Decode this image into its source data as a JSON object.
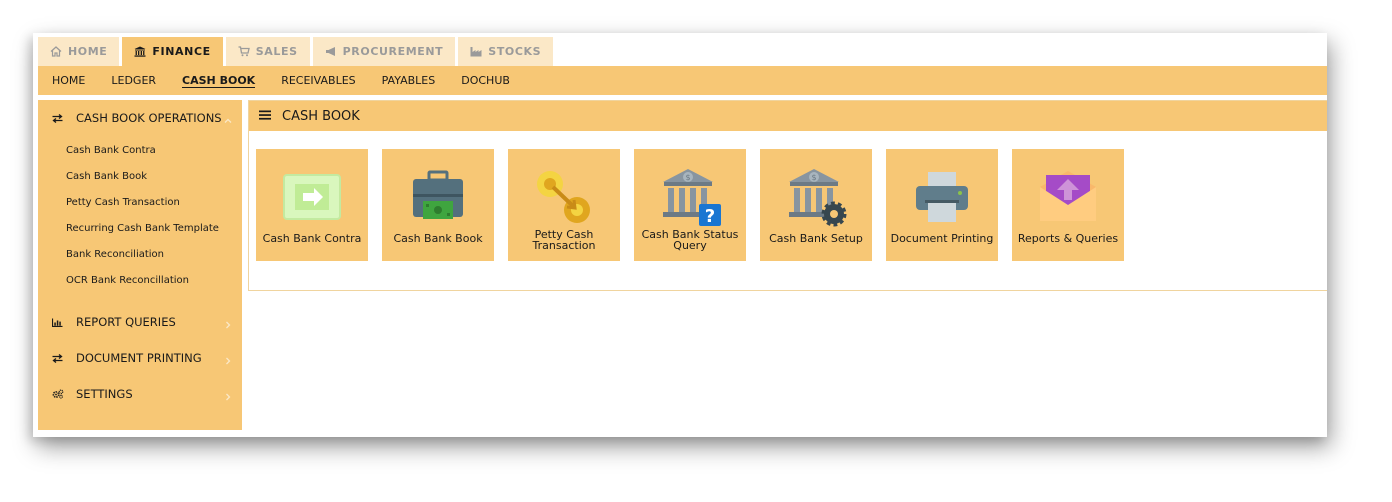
{
  "top_tabs": [
    {
      "label": "HOME",
      "icon": "home-icon"
    },
    {
      "label": "FINANCE",
      "icon": "bank-icon",
      "active": true
    },
    {
      "label": "SALES",
      "icon": "cart-icon"
    },
    {
      "label": "PROCUREMENT",
      "icon": "megaphone-icon"
    },
    {
      "label": "STOCKS",
      "icon": "factory-icon"
    }
  ],
  "sub_nav": [
    {
      "label": "HOME"
    },
    {
      "label": "LEDGER"
    },
    {
      "label": "CASH BOOK",
      "active": true
    },
    {
      "label": "RECEIVABLES"
    },
    {
      "label": "PAYABLES"
    },
    {
      "label": "DOCHUB"
    }
  ],
  "sidebar": {
    "sections": [
      {
        "label": "CASH BOOK OPERATIONS",
        "icon": "exchange-icon",
        "expanded": true,
        "items": [
          {
            "label": "Cash Bank Contra"
          },
          {
            "label": "Cash Bank Book"
          },
          {
            "label": "Petty Cash Transaction"
          },
          {
            "label": "Recurring Cash Bank Template"
          },
          {
            "label": "Bank Reconciliation"
          },
          {
            "label": "OCR Bank Reconcillation"
          }
        ]
      },
      {
        "label": "REPORT QUERIES",
        "icon": "bar-chart-icon",
        "expanded": false
      },
      {
        "label": "DOCUMENT PRINTING",
        "icon": "exchange-icon",
        "expanded": false
      },
      {
        "label": "SETTINGS",
        "icon": "cogs-icon",
        "expanded": false
      }
    ]
  },
  "panel": {
    "title": "CASH BOOK",
    "tiles": [
      {
        "label": "Cash Bank Contra",
        "icon": "contra-arrow-icon"
      },
      {
        "label": "Cash Bank Book",
        "icon": "cash-register-icon"
      },
      {
        "label": "Petty Cash Transaction",
        "icon": "coin-transfer-icon"
      },
      {
        "label": "Cash Bank Status Query",
        "icon": "bank-query-icon"
      },
      {
        "label": "Cash Bank Setup",
        "icon": "bank-setup-icon"
      },
      {
        "label": "Document Printing",
        "icon": "printer-icon"
      },
      {
        "label": "Reports & Queries",
        "icon": "report-envelope-icon"
      }
    ]
  },
  "colors": {
    "accent": "#f7c775",
    "tab_inactive_bg": "#fbe8c7",
    "tab_inactive_text": "#9a9a9a",
    "text": "#1a1a1a"
  }
}
